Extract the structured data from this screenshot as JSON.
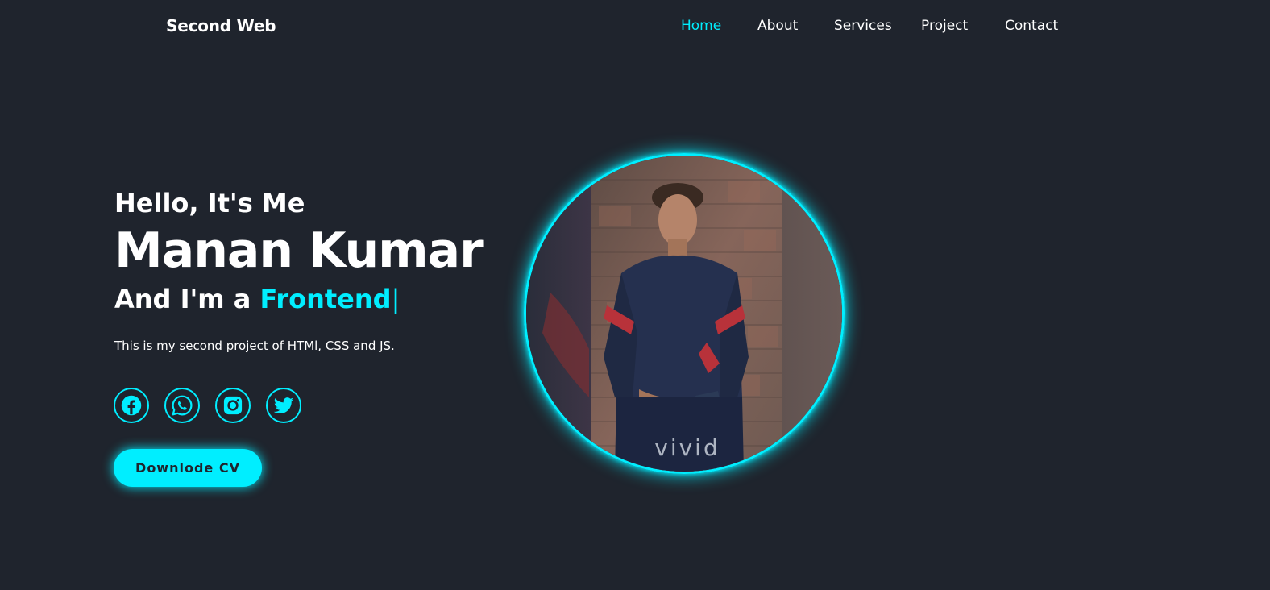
{
  "header": {
    "logo": "Second Web",
    "nav": [
      {
        "label": "Home",
        "active": true
      },
      {
        "label": "About",
        "active": false
      },
      {
        "label": "Services",
        "active": false
      },
      {
        "label": "Project",
        "active": false
      },
      {
        "label": "Contact",
        "active": false
      }
    ]
  },
  "hero": {
    "greeting": "Hello, It's Me",
    "name": "Manan Kumar",
    "role_prefix": "And I'm a ",
    "role_typed": "Frontend",
    "role_cursor": "|",
    "description": "This is my second project of HTMl, CSS and JS.",
    "social": [
      {
        "icon": "facebook-icon"
      },
      {
        "icon": "whatsapp-icon"
      },
      {
        "icon": "instagram-icon"
      },
      {
        "icon": "twitter-icon"
      }
    ],
    "cta_label": "Downlode CV",
    "photo_watermark": "vivid"
  },
  "colors": {
    "background": "#1f242d",
    "accent": "#00eeff",
    "text": "#ffffff"
  }
}
